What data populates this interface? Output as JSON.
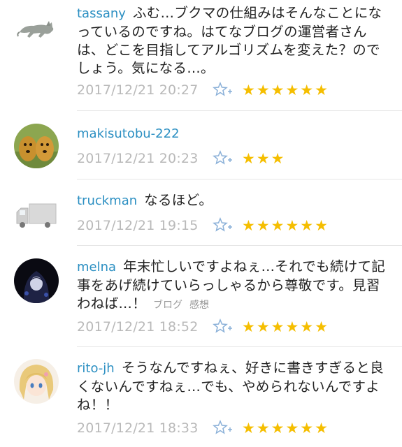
{
  "comments": [
    {
      "user": "tassany",
      "text": "ふむ…ブクマの仕組みはそんなことになっているのですね。はてなブログの運営者さんは、どこを目指してアルゴリズムを変えた？のでしょう。気になる…。",
      "tags": [],
      "time": "2017/12/21 20:27",
      "stars": "★★★★★★",
      "star_count": 6,
      "avatar": "cat-avatar"
    },
    {
      "user": "makisutobu-222",
      "text": "",
      "tags": [],
      "time": "2017/12/21 20:23",
      "stars": "★★★",
      "star_count": 3,
      "avatar": "dogs-avatar"
    },
    {
      "user": "truckman",
      "text": "なるほど。",
      "tags": [],
      "time": "2017/12/21 19:15",
      "stars": "★★★★★★",
      "star_count": 6,
      "avatar": "truck-avatar"
    },
    {
      "user": "melna",
      "text": "年末忙しいですよねぇ…それでも続けて記事をあげ続けていらっしゃるから尊敬です。見習わねば…！",
      "tags": [
        "ブログ",
        "感想"
      ],
      "time": "2017/12/21 18:52",
      "stars": "★★★★★★",
      "star_count": 6,
      "avatar": "hooded-figure-avatar"
    },
    {
      "user": "rito-jh",
      "text": "そうなんですねぇ、好きに書きすぎると良くないんですねぇ…でも、やめられないんですよね！！",
      "tags": [],
      "time": "2017/12/21 18:33",
      "stars": "★★★★★★",
      "star_count": 6,
      "avatar": "anime-girl-avatar"
    }
  ],
  "icons": {
    "add_star": "add-star-icon"
  },
  "colors": {
    "username": "#2b8fc2",
    "star": "#f5be00",
    "timestamp": "#b9b9b9",
    "tag": "#9a9a9a"
  }
}
